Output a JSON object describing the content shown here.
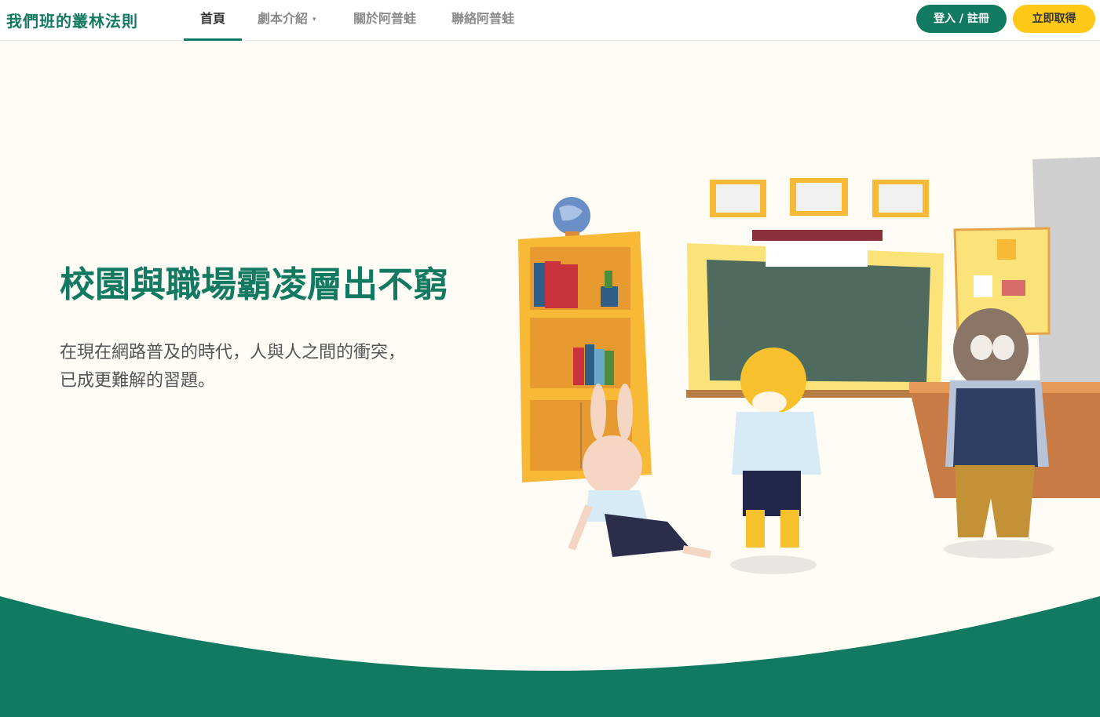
{
  "nav": {
    "logo": "我們班的叢林法則",
    "items": [
      {
        "label": "首頁"
      },
      {
        "label": "劇本介紹"
      },
      {
        "label": "關於阿普蛙"
      },
      {
        "label": "聯絡阿普蛙"
      }
    ],
    "caret": "▾",
    "login_label": "登入 / 註冊",
    "get_label": "立即取得"
  },
  "hero": {
    "title": "校園與職場霸凌層出不窮",
    "desc_line1": "在現在網路普及的時代，人與人之間的衝突，",
    "desc_line2": "已成更難解的習題。"
  },
  "colors": {
    "brand_green": "#137a62",
    "accent_yellow": "#ffc915",
    "background": "#fffcf5"
  }
}
